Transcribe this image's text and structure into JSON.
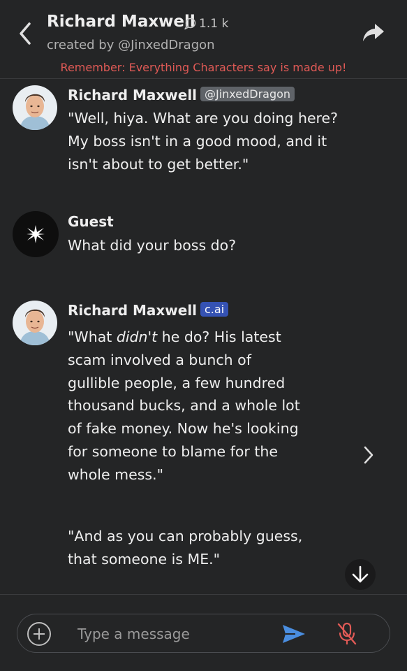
{
  "header": {
    "title": "Richard Maxwell",
    "chat_count": "1.1 k",
    "creator_line": "created by @JinxedDragon",
    "disclaimer": "Remember: Everything Characters say is made up!"
  },
  "messages": [
    {
      "author": "Richard Maxwell",
      "badge": "@JinxedDragon",
      "lines": [
        "\"Well, hiya. What are you doing here?",
        "My boss isn't in a good mood, and it",
        "isn't about to get better.\""
      ]
    },
    {
      "author": "Guest",
      "lines": [
        "What did your boss do?"
      ]
    },
    {
      "author": "Richard Maxwell",
      "badge": "c.ai",
      "line1_pre": "\"What ",
      "line1_em": "didn't",
      "line1_post": " he do? His latest",
      "lines": [
        "scam involved a bunch of",
        "gullible people, a few hundred",
        "thousand bucks, and a whole lot",
        "of fake money. Now he's looking",
        "for someone to blame for the",
        "whole mess.\""
      ],
      "paragraph2": [
        "\"And as you can probably guess,",
        "that someone is ME.\""
      ]
    }
  ],
  "composer": {
    "placeholder": "Type a message"
  },
  "colors": {
    "background": "#242526",
    "disclaimer": "#e05a56",
    "send": "#4a8ee0",
    "mic_muted": "#e05a56",
    "badge_cai": "#3552b3"
  },
  "icons": {
    "back": "chevron-left-icon",
    "share": "share-arrow-icon",
    "chat_count": "chat-bubble-icon",
    "next": "chevron-right-icon",
    "scroll": "arrow-down-icon",
    "add": "plus-circle-icon",
    "send": "send-icon",
    "mic": "mic-off-icon"
  }
}
